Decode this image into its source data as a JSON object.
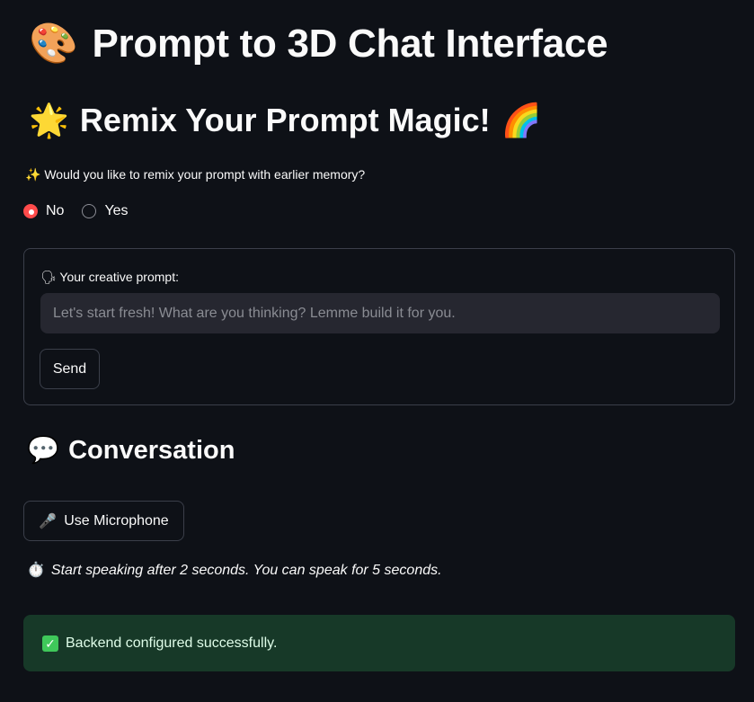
{
  "header": {
    "title_icon": "🎨",
    "title": "Prompt to 3D Chat Interface"
  },
  "remix_section": {
    "icon": "🌟",
    "title": "Remix Your Prompt Magic!",
    "icon_after": "🌈",
    "question_icon": "✨",
    "question": "Would you like to remix your prompt with earlier memory?",
    "options": [
      {
        "label": "No",
        "selected": true
      },
      {
        "label": "Yes",
        "selected": false
      }
    ]
  },
  "prompt_form": {
    "label_icon": "🗣",
    "label": "Your creative prompt:",
    "placeholder": "Let's start fresh! What are you thinking? Lemme build it for you.",
    "value": "",
    "send_label": "Send"
  },
  "conversation": {
    "icon": "💬",
    "title": "Conversation",
    "mic_icon": "🎤",
    "mic_label": "Use Microphone",
    "hint_icon": "⏱️",
    "hint": "Start speaking after 2 seconds. You can speak for 5 seconds."
  },
  "status": {
    "icon": "✓",
    "message": "Backend configured successfully.",
    "color": "#173928"
  },
  "colors": {
    "background": "#0e1117",
    "accent": "#ff4b4b",
    "input_bg": "#262730",
    "border": "#3b3f4a",
    "success_bg": "#173928"
  }
}
